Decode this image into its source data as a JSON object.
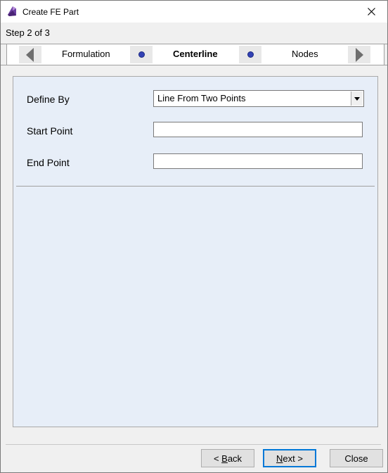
{
  "window": {
    "title": "Create FE Part",
    "close_icon": "close-icon"
  },
  "header": {
    "step_text": "Step 2 of 3"
  },
  "wizard": {
    "prev_icon": "triangle-left-icon",
    "next_icon": "triangle-right-icon",
    "steps": [
      {
        "label": "Formulation",
        "active": false
      },
      {
        "label": "Centerline",
        "active": true
      },
      {
        "label": "Nodes",
        "active": false
      }
    ],
    "dot_color": "#3342b5"
  },
  "form": {
    "define_by": {
      "label": "Define By",
      "value": "Line From Two Points"
    },
    "start_point": {
      "label": "Start Point",
      "value": "",
      "placeholder": ""
    },
    "end_point": {
      "label": "End Point",
      "value": "",
      "placeholder": ""
    }
  },
  "buttons": {
    "back": {
      "prefix": "< ",
      "mnemonic": "B",
      "rest": "ack"
    },
    "next": {
      "mnemonic": "N",
      "rest": "ext >"
    },
    "close": "Close"
  },
  "colors": {
    "panel_bg": "#e7eef8",
    "default_button_border": "#0078d7"
  }
}
